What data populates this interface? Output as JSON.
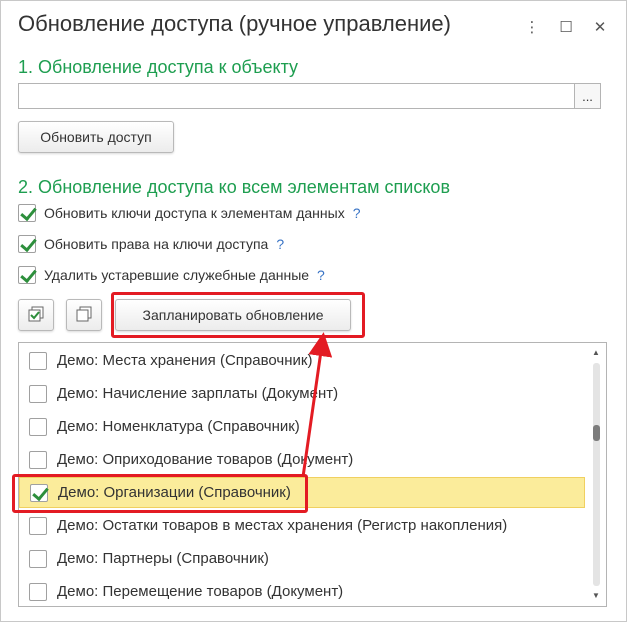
{
  "window": {
    "title": "Обновление доступа (ручное управление)",
    "controls": [
      {
        "icon": "more-vertical-icon",
        "glyph": "⋮"
      },
      {
        "icon": "maximize-icon",
        "glyph": "☐"
      },
      {
        "icon": "close-icon",
        "glyph": "✕"
      }
    ]
  },
  "section1": {
    "title": "1. Обновление доступа к объекту",
    "object_input": {
      "value": "",
      "placeholder": ""
    },
    "select_button": "...",
    "update_button": "Обновить доступ"
  },
  "section2": {
    "title": "2. Обновление доступа ко всем элементам списков",
    "options": [
      {
        "label": "Обновить ключи доступа к элементам данных",
        "checked": true,
        "help": "?"
      },
      {
        "label": "Обновить права на ключи доступа",
        "checked": true,
        "help": "?"
      },
      {
        "label": "Удалить устаревшие служебные данные",
        "checked": true,
        "help": "?"
      }
    ],
    "toolbar": {
      "check_all_icon": "check-all-icon",
      "uncheck_all_icon": "uncheck-all-icon",
      "schedule_button": "Запланировать обновление"
    }
  },
  "list": {
    "items": [
      {
        "label": "Демо: Места хранения (Справочник)",
        "checked": false,
        "selected": false
      },
      {
        "label": "Демо: Начисление зарплаты (Документ)",
        "checked": false,
        "selected": false
      },
      {
        "label": "Демо: Номенклатура (Справочник)",
        "checked": false,
        "selected": false
      },
      {
        "label": "Демо: Оприходование товаров (Документ)",
        "checked": false,
        "selected": false
      },
      {
        "label": "Демо: Организации (Справочник)",
        "checked": true,
        "selected": true
      },
      {
        "label": "Демо: Остатки товаров в местах хранения (Регистр накопления)",
        "checked": false,
        "selected": false
      },
      {
        "label": "Демо: Партнеры (Справочник)",
        "checked": false,
        "selected": false
      },
      {
        "label": "Демо: Перемещение товаров (Документ)",
        "checked": false,
        "selected": false
      }
    ],
    "scroll_position": 0.3
  },
  "colors": {
    "section_title": "#1e9e50",
    "help": "#3873c5",
    "highlight": "#e31b23",
    "selection": "#fbec9b",
    "check": "#2d8f3c"
  }
}
